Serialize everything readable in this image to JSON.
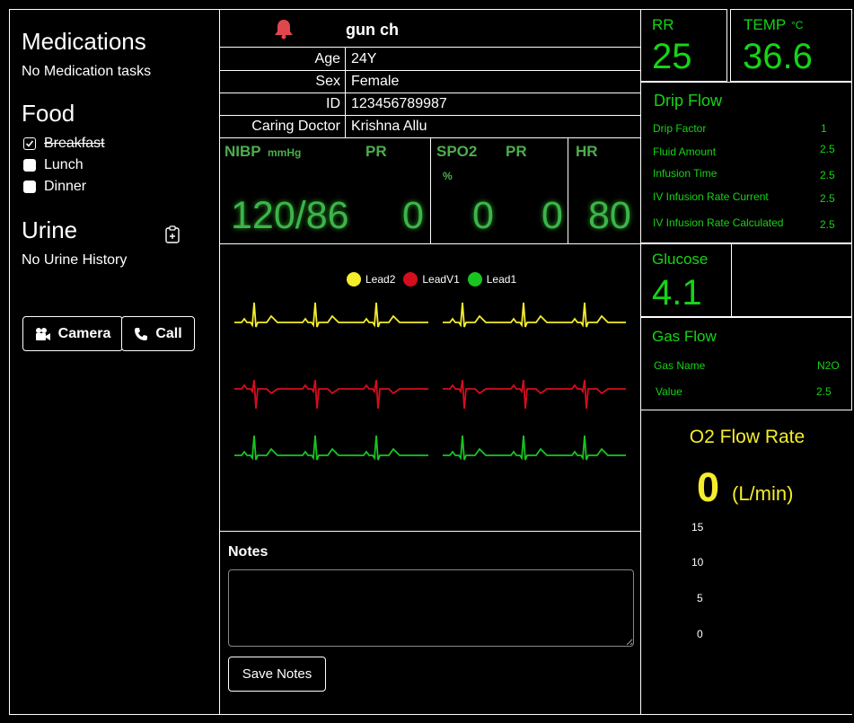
{
  "left": {
    "medications_title": "Medications",
    "medications_empty": "No Medication tasks",
    "food_title": "Food",
    "food_items": [
      {
        "label": "Breakfast",
        "checked": true
      },
      {
        "label": "Lunch",
        "checked": false
      },
      {
        "label": "Dinner",
        "checked": false
      }
    ],
    "urine_title": "Urine",
    "urine_empty": "No Urine History",
    "camera_label": "Camera",
    "call_label": "Call"
  },
  "patient": {
    "name": "gun ch",
    "rows": [
      {
        "label": "Age",
        "value": "24Y"
      },
      {
        "label": "Sex",
        "value": "Female"
      },
      {
        "label": "ID",
        "value": "123456789987"
      },
      {
        "label": "Caring Doctor",
        "value": "Krishna Allu"
      }
    ]
  },
  "vitals": {
    "nibp_label": "NIBP",
    "nibp_unit": "mmHg",
    "pr_label": "PR",
    "nibp_value": "120/86",
    "pr_value": "0",
    "spo2_label": "SPO2",
    "spo2_unit": "%",
    "spo2_pr_label": "PR",
    "spo2_value": "0",
    "spo2_pr_value": "0",
    "hr_label": "HR",
    "hr_value": "80"
  },
  "ecg": {
    "leads": [
      {
        "name": "Lead2",
        "color": "#f5ed2c"
      },
      {
        "name": "LeadV1",
        "color": "#d40e1e"
      },
      {
        "name": "Lead1",
        "color": "#19c421"
      }
    ]
  },
  "notes": {
    "title": "Notes",
    "placeholder": "",
    "save_label": "Save Notes"
  },
  "right": {
    "rr_label": "RR",
    "rr_value": "25",
    "temp_label": "TEMP",
    "temp_unit": "°C",
    "temp_value": "36.6",
    "drip_title": "Drip Flow",
    "drip_rows": [
      {
        "label": "Drip Factor",
        "value": "1"
      },
      {
        "label": "Fluid Amount",
        "value": "2.5"
      },
      {
        "label": "Infusion Time",
        "value": "2.5"
      },
      {
        "label": "IV Infusion Rate Current",
        "value": "2.5"
      },
      {
        "label": "IV Infusion Rate Calculated",
        "value": "2.5"
      }
    ],
    "glucose_label": "Glucose",
    "glucose_value": "4.1",
    "gas_title": "Gas Flow",
    "gas_rows": [
      {
        "label": "Gas Name",
        "value": "N2O"
      },
      {
        "label": "Value",
        "value": "2.5"
      }
    ],
    "o2_title": "O2 Flow Rate",
    "o2_value": "0",
    "o2_unit": "(L/min)",
    "o2_ticks": [
      "15",
      "10",
      "5",
      "0"
    ]
  },
  "colors": {
    "accent_green": "#16d416",
    "vital_green": "#3cb54a",
    "o2_yellow": "#f5ed2c",
    "bell_red": "#e0474c"
  }
}
